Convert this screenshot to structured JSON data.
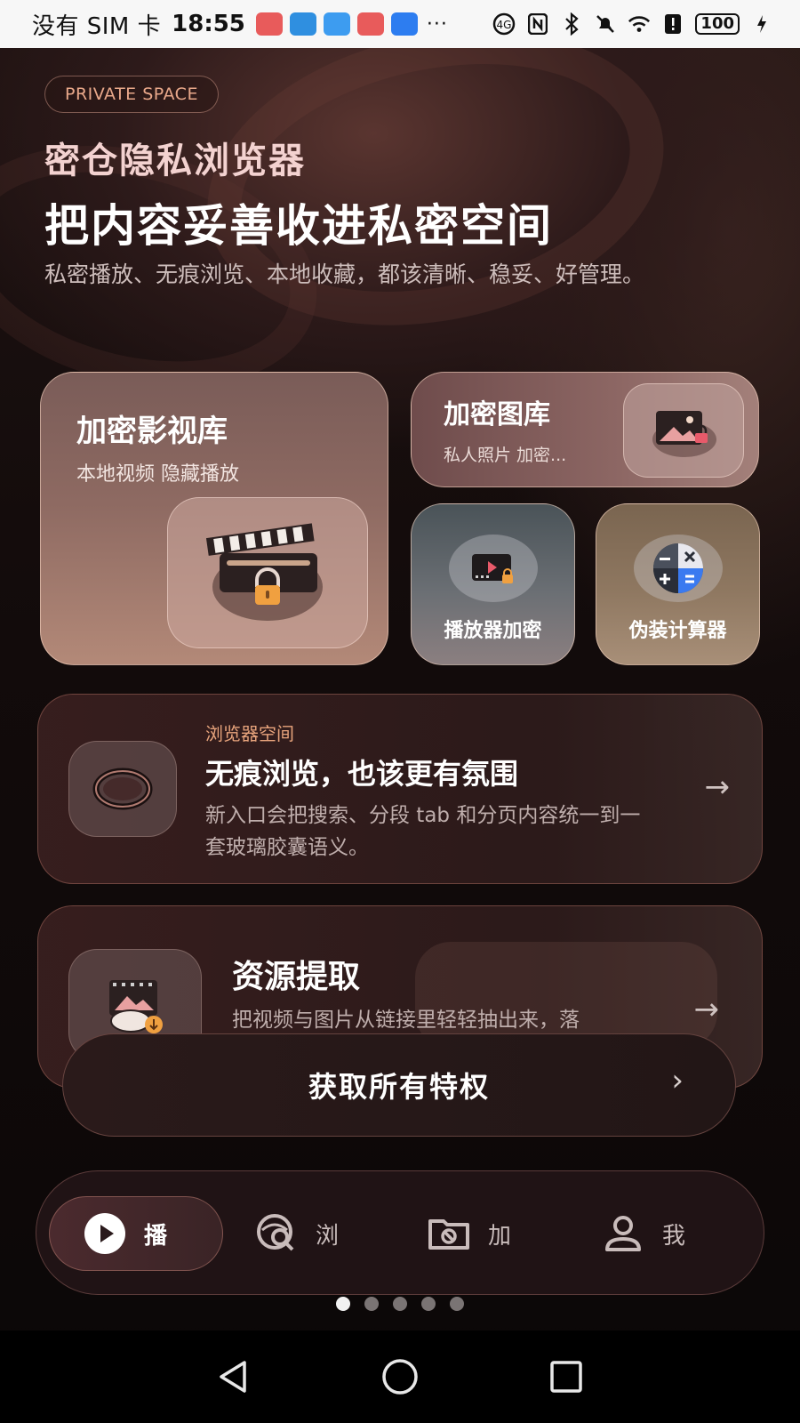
{
  "status_bar": {
    "carrier": "没有 SIM 卡",
    "time": "18:55",
    "dots": "···",
    "battery": "100"
  },
  "header": {
    "tag": "PRIVATE SPACE",
    "brand": "密仓隐私浏览器",
    "headline": "把内容妥善收进私密空间",
    "subline": "私密播放、无痕浏览、本地收藏，都该清晰、稳妥、好管理。"
  },
  "cards": {
    "vault": {
      "title": "加密影视库",
      "subtitle": "本地视频 隐藏播放"
    },
    "gallery": {
      "title": "加密图库",
      "subtitle": "私人照片 加密..."
    },
    "player": {
      "title": "播放器加密"
    },
    "calculator": {
      "title": "伪装计算器"
    }
  },
  "browser_row": {
    "kicker": "浏览器空间",
    "title": "无痕浏览，也该更有氛围",
    "desc": "新入口会把搜索、分段 tab 和分页内容统一到一套玻璃胶囊语义。",
    "arrow": "→"
  },
  "extract_row": {
    "title": "资源提取",
    "desc": "把视频与图片从链接里轻轻抽出来，落",
    "arrow": "→"
  },
  "cta": {
    "label": "获取所有特权",
    "chevron": "›"
  },
  "bottom_nav": {
    "items": [
      {
        "label": "播",
        "icon": "play-icon",
        "active": true
      },
      {
        "label": "浏",
        "icon": "browse-search-icon",
        "active": false
      },
      {
        "label": "加",
        "icon": "encrypted-folder-icon",
        "active": false
      },
      {
        "label": "我",
        "icon": "person-icon",
        "active": false
      }
    ]
  },
  "pager": {
    "count": 5,
    "active_index": 0
  },
  "colors": {
    "accent_orange": "#e8a47c",
    "tag_text": "#e9a88a",
    "brand_pink": "#f3d2d0",
    "lock_orange": "#f0a040"
  }
}
